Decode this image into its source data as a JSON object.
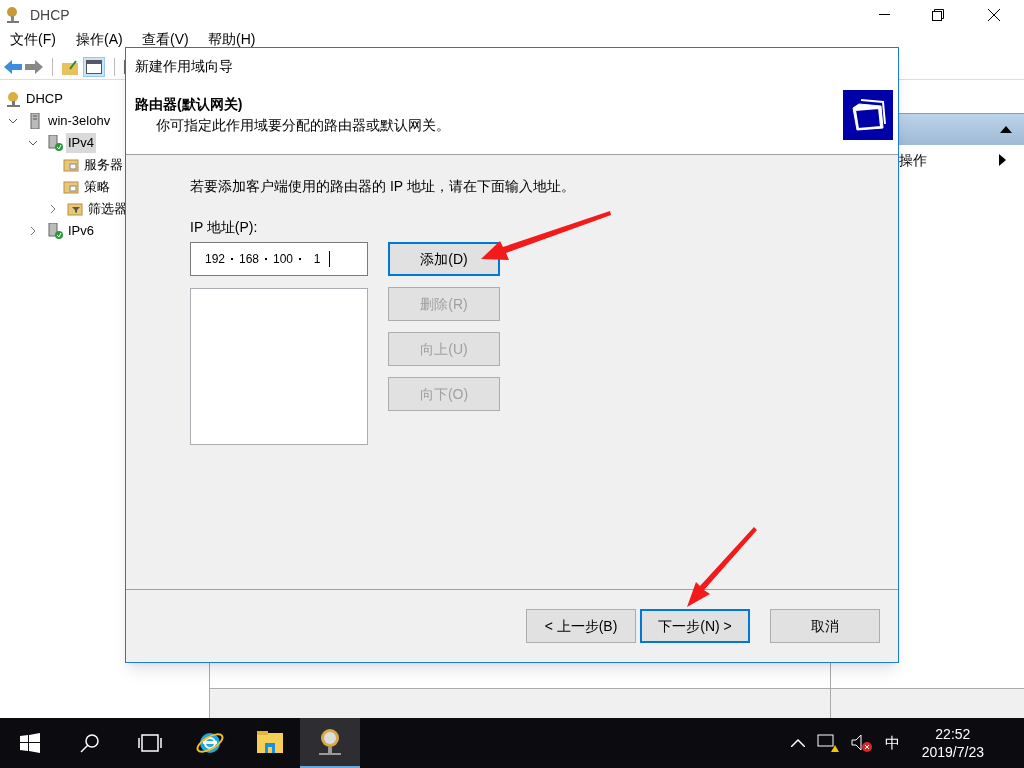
{
  "window": {
    "title": "DHCP"
  },
  "menu": [
    "文件(F)",
    "操作(A)",
    "查看(V)",
    "帮助(H)"
  ],
  "tree": [
    {
      "label": "DHCP",
      "selected": false,
      "children": [
        {
          "label": "win-3elohv",
          "expanded": true,
          "selected": false,
          "children": [
            {
              "label": "IPv4",
              "expanded": true,
              "selected": true,
              "children": [
                {
                  "label": "服务器",
                  "selected": false
                },
                {
                  "label": "策略",
                  "selected": false
                },
                {
                  "label": "筛选器",
                  "expanded": false,
                  "selected": false
                }
              ]
            },
            {
              "label": "IPv6",
              "expanded": false,
              "selected": false
            }
          ]
        }
      ]
    }
  ],
  "actions_pane": {
    "items": [
      {
        "label": "操作"
      }
    ]
  },
  "dialog": {
    "title": "新建作用域向导",
    "header_title": "路由器(默认网关)",
    "header_subtitle": "你可指定此作用域要分配的路由器或默认网关。",
    "instruction": "若要添加客户端使用的路由器的 IP 地址，请在下面输入地址。",
    "ip_label": "IP 地址(P):",
    "ip_octets": [
      "192",
      "168",
      "100",
      "1"
    ],
    "side_buttons": [
      {
        "label": "添加(D)",
        "disabled": false,
        "default": true
      },
      {
        "label": "删除(R)",
        "disabled": true,
        "default": false
      },
      {
        "label": "向上(U)",
        "disabled": true,
        "default": false
      },
      {
        "label": "向下(O)",
        "disabled": true,
        "default": false
      }
    ],
    "nav_buttons": [
      {
        "label": "< 上一步(B)",
        "focused": false
      },
      {
        "label": "下一步(N) >",
        "focused": true
      },
      {
        "label": "取消",
        "focused": false
      }
    ]
  },
  "taskbar": {
    "apps": [
      {
        "kind": "ie",
        "selected": false
      },
      {
        "kind": "explorer",
        "selected": false
      },
      {
        "kind": "dhcp",
        "selected": true
      }
    ],
    "ime": "中",
    "time": "22:52",
    "date": "2019/7/23"
  }
}
